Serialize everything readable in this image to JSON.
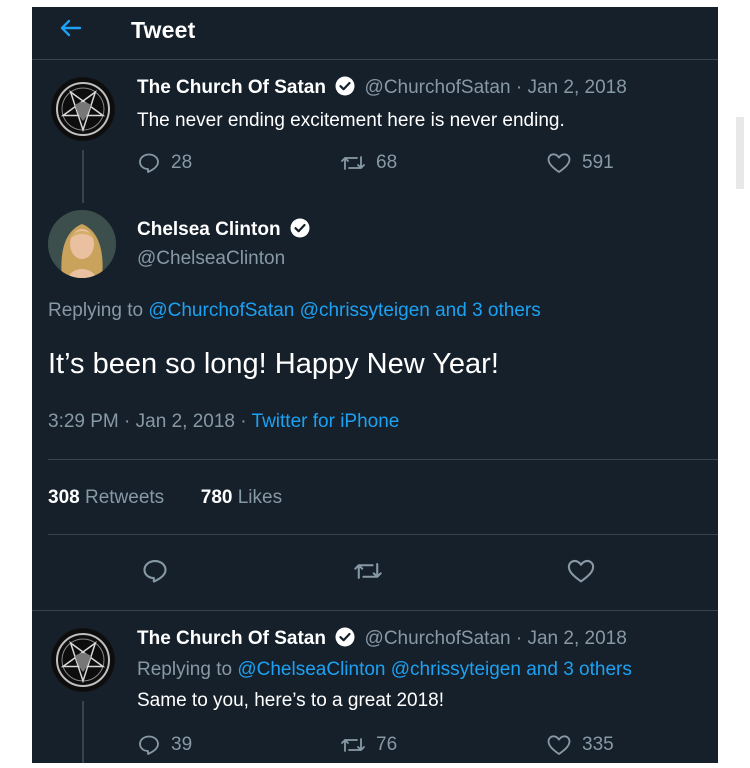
{
  "header": {
    "title": "Tweet"
  },
  "colors": {
    "background": "#15202b",
    "accent": "#1da1f2",
    "secondary_text": "#8899a6",
    "divider": "#38444d"
  },
  "parent_tweet": {
    "name": "The Church Of Satan",
    "handle": "@ChurchofSatan",
    "date": "Jan 2, 2018",
    "text": "The never ending excitement here is never ending.",
    "replies": "28",
    "retweets": "68",
    "likes": "591"
  },
  "main_tweet": {
    "name": "Chelsea Clinton",
    "handle": "@ChelseaClinton",
    "replying_prefix": "Replying to",
    "replying_to": "@ChurchofSatan @chrissyteigen and 3 others",
    "text": "It’s been so long! Happy New Year!",
    "time": "3:29 PM",
    "date": "Jan 2, 2018",
    "source": "Twitter for iPhone",
    "retweet_count": "308",
    "retweet_label": "Retweets",
    "like_count": "780",
    "like_label": "Likes"
  },
  "reply_tweet": {
    "name": "The Church Of Satan",
    "handle": "@ChurchofSatan",
    "date": "Jan 2, 2018",
    "replying_prefix": "Replying to",
    "replying_to": "@ChelseaClinton @chrissyteigen and 3 others",
    "text": "Same to you, here’s to a great 2018!",
    "replies": "39",
    "retweets": "76",
    "likes": "335"
  },
  "icons": [
    "back-arrow-icon",
    "verified-badge-icon",
    "reply-icon",
    "retweet-icon",
    "like-icon",
    "pentagram-avatar"
  ]
}
